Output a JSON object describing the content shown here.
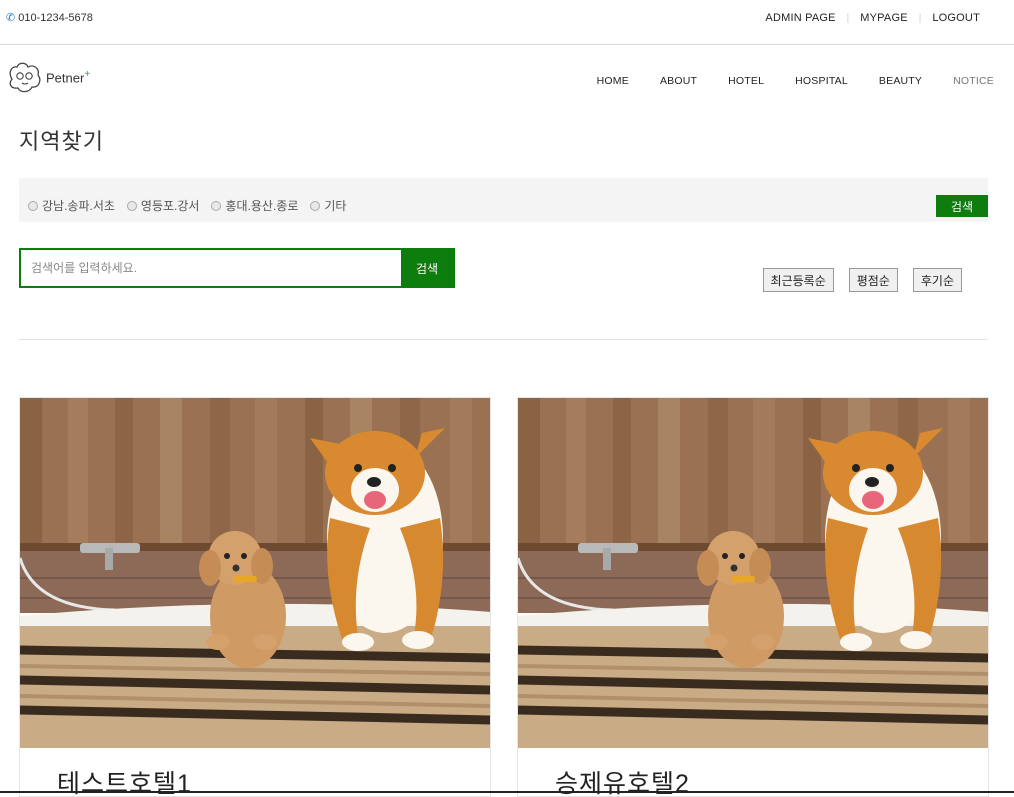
{
  "topbar": {
    "phone": "010-1234-5678",
    "links": [
      "ADMIN PAGE",
      "MYPAGE",
      "LOGOUT"
    ]
  },
  "nav": {
    "brand": "Petner",
    "brand_plus": "+",
    "menu": [
      "HOME",
      "ABOUT",
      "HOTEL",
      "HOSPITAL",
      "BEAUTY",
      "NOTICE"
    ]
  },
  "page": {
    "title": "지역찾기"
  },
  "filter": {
    "regions": [
      "강남.송파.서초",
      "영등포.강서",
      "홍대.용산.종로",
      "기타"
    ],
    "button": "검색"
  },
  "search": {
    "placeholder": "검색어를 입력하세요.",
    "button": "검색"
  },
  "sort": [
    "최근등록순",
    "평점순",
    "후기순"
  ],
  "hotels": [
    {
      "name": "테스트호텔1"
    },
    {
      "name": "승제유호텔2"
    }
  ],
  "colors": {
    "accent": "#0d7d0d",
    "plus": "#2a9d4b"
  }
}
